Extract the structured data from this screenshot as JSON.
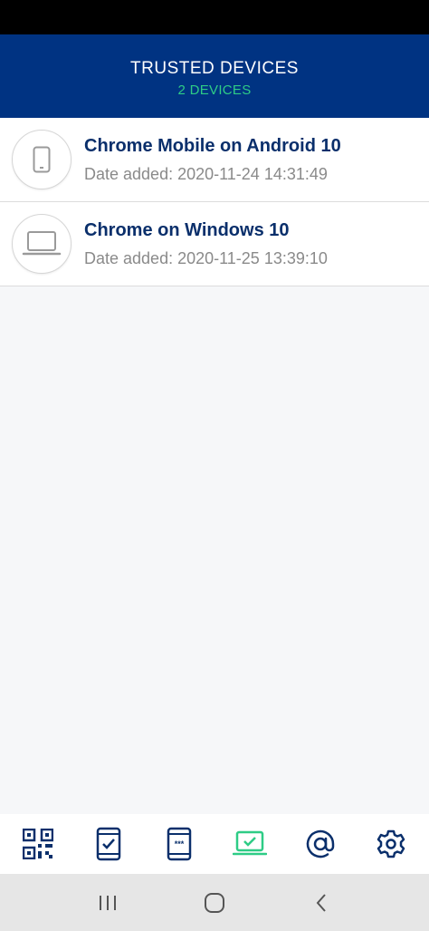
{
  "header": {
    "title": "TRUSTED DEVICES",
    "subtitle": "2 DEVICES"
  },
  "devices": [
    {
      "name": "Chrome Mobile on Android 10",
      "date": "Date added: 2020-11-24 14:31:49",
      "icon": "smartphone-icon"
    },
    {
      "name": "Chrome on Windows 10",
      "date": "Date added: 2020-11-25 13:39:10",
      "icon": "laptop-icon"
    }
  ],
  "bottom_tabs": [
    {
      "name": "qr-code",
      "active": false
    },
    {
      "name": "phone-check",
      "active": false
    },
    {
      "name": "phone-pin",
      "active": false
    },
    {
      "name": "trusted-devices",
      "active": true
    },
    {
      "name": "email",
      "active": false
    },
    {
      "name": "settings",
      "active": false
    }
  ],
  "colors": {
    "header_bg": "#003382",
    "accent": "#2ecc86",
    "tab_icon": "#0a2f6b",
    "device_name": "#0a2f6b"
  }
}
